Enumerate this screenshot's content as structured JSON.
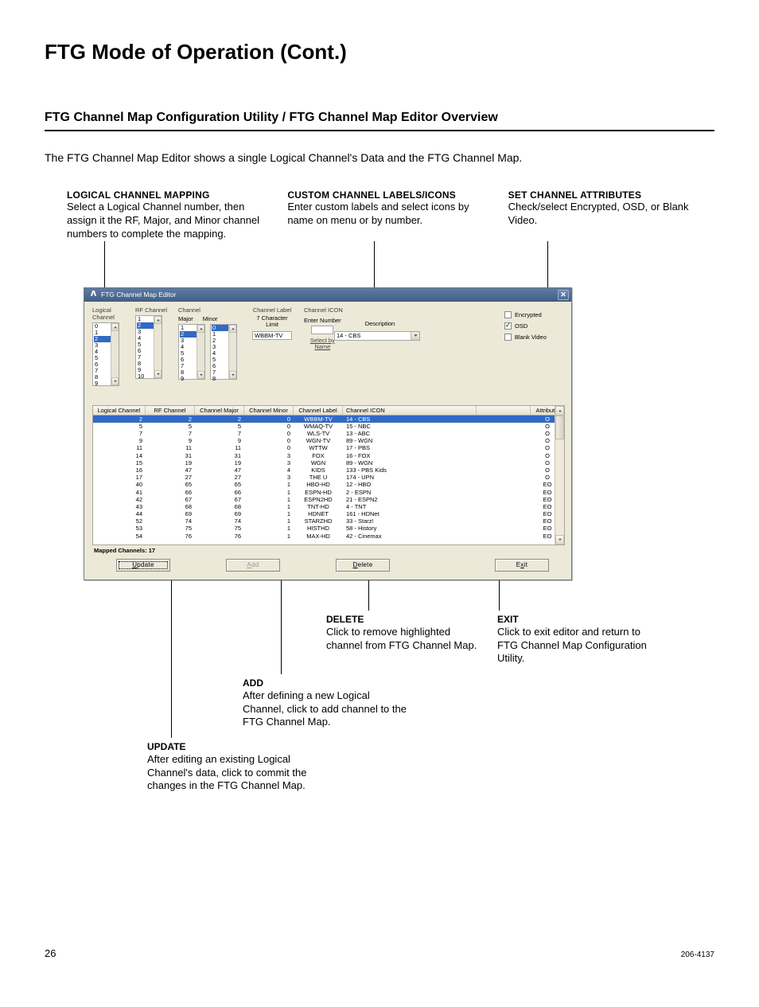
{
  "page": {
    "title": "FTG Mode of Operation (Cont.)",
    "subtitle": "FTG Channel Map Configuration Utility / FTG Channel Map Editor Overview",
    "intro": "The FTG Channel Map Editor shows a single Logical Channel's Data and the FTG Channel Map.",
    "number": "26",
    "docnum": "206-4137"
  },
  "callouts": {
    "top": [
      {
        "title": "LOGICAL CHANNEL MAPPING",
        "body": "Select a Logical Channel number, then assign it the RF, Major, and Minor channel numbers to complete the mapping."
      },
      {
        "title": "CUSTOM CHANNEL LABELS/ICONS",
        "body": "Enter custom labels and select icons by name on menu or by number."
      },
      {
        "title": "SET CHANNEL ATTRIBUTES",
        "body": "Check/select Encrypted, OSD, or Blank Video."
      }
    ],
    "bottom": {
      "delete": {
        "title": "DELETE",
        "body": "Click to remove highlighted channel from FTG Channel Map."
      },
      "exit": {
        "title": "EXIT",
        "body": "Click to exit editor and return to FTG Channel Map Configuration Utility."
      },
      "add": {
        "title": "ADD",
        "body": "After defining a new Logical Channel, click to add channel to the FTG Channel Map."
      },
      "update": {
        "title": "UPDATE",
        "body": "After editing an existing Logical Channel's data, click to commit the changes in the FTG Channel Map."
      }
    }
  },
  "dialog": {
    "title": "FTG Channel Map Editor",
    "labels": {
      "logical_channel": "Logical Channel",
      "rf_channel": "RF Channel",
      "channel": "Channel",
      "major": "Major",
      "minor": "Minor",
      "channel_label": "Channel Label",
      "seven_char_limit_a": "7 Character",
      "seven_char_limit_b": "Limit",
      "channel_icon": "Channel ICON",
      "enter_number": "Enter Number",
      "description": "Description",
      "select_by_name": "Select by\nName",
      "encrypted": "Encrypted",
      "osd": "OSD",
      "blank_video": "Blank Video",
      "mapped_channels": "Mapped Channels:  17"
    },
    "logical_items": [
      "0",
      "1",
      "2",
      "3",
      "4",
      "5",
      "6",
      "7",
      "8",
      "9"
    ],
    "logical_sel": 2,
    "rf_items": [
      "1",
      "2",
      "3",
      "4",
      "5",
      "6",
      "7",
      "8",
      "9",
      "10"
    ],
    "rf_sel": 1,
    "major_items": [
      "1",
      "2",
      "3",
      "4",
      "5",
      "6",
      "7",
      "8",
      "9"
    ],
    "major_sel": 1,
    "minor_items": [
      "0",
      "1",
      "2",
      "3",
      "4",
      "5",
      "6",
      "7",
      "8"
    ],
    "minor_sel": 0,
    "label_value": "WBBM-TV",
    "icon_value": "14 - CBS",
    "attrs": {
      "encrypted": false,
      "osd": true,
      "blank_video": false
    },
    "grid": {
      "headers": [
        "Logical Channel",
        "RF Channel",
        "Channel Major",
        "Channel Minor",
        "Channel Label",
        "Channel ICON",
        "",
        "Attribute"
      ],
      "rows": [
        {
          "lc": "2",
          "rf": "2",
          "maj": "2",
          "min": "0",
          "lbl": "WBBM-TV",
          "icon": "14 - CBS",
          "attr": "O",
          "sel": true
        },
        {
          "lc": "5",
          "rf": "5",
          "maj": "5",
          "min": "0",
          "lbl": "WMAQ-TV",
          "icon": "15 - NBC",
          "attr": "O"
        },
        {
          "lc": "7",
          "rf": "7",
          "maj": "7",
          "min": "0",
          "lbl": "WLS-TV",
          "icon": "13 - ABC",
          "attr": "O"
        },
        {
          "lc": "9",
          "rf": "9",
          "maj": "9",
          "min": "0",
          "lbl": "WGN-TV",
          "icon": "89 - WGN",
          "attr": "O"
        },
        {
          "lc": "11",
          "rf": "11",
          "maj": "11",
          "min": "0",
          "lbl": "WTTW",
          "icon": "17 - PBS",
          "attr": "O"
        },
        {
          "lc": "14",
          "rf": "31",
          "maj": "31",
          "min": "3",
          "lbl": "FOX",
          "icon": "16 - FOX",
          "attr": "O"
        },
        {
          "lc": "15",
          "rf": "19",
          "maj": "19",
          "min": "3",
          "lbl": "WGN",
          "icon": "89 - WGN",
          "attr": "O"
        },
        {
          "lc": "16",
          "rf": "47",
          "maj": "47",
          "min": "4",
          "lbl": "KIDS",
          "icon": "133 - PBS Kids",
          "attr": "O"
        },
        {
          "lc": "17",
          "rf": "27",
          "maj": "27",
          "min": "3",
          "lbl": "THE U",
          "icon": "174 - UPN",
          "attr": "O"
        },
        {
          "lc": "40",
          "rf": "65",
          "maj": "65",
          "min": "1",
          "lbl": "HBO-HD",
          "icon": "12 - HBO",
          "attr": "EO"
        },
        {
          "lc": "41",
          "rf": "66",
          "maj": "66",
          "min": "1",
          "lbl": "ESPN-HD",
          "icon": "2 - ESPN",
          "attr": "EO"
        },
        {
          "lc": "42",
          "rf": "67",
          "maj": "67",
          "min": "1",
          "lbl": "ESPN2HD",
          "icon": "21 - ESPN2",
          "attr": "EO"
        },
        {
          "lc": "43",
          "rf": "68",
          "maj": "68",
          "min": "1",
          "lbl": "TNT-HD",
          "icon": "4 - TNT",
          "attr": "EO"
        },
        {
          "lc": "44",
          "rf": "69",
          "maj": "69",
          "min": "1",
          "lbl": "HDNET",
          "icon": "161 - HDNet",
          "attr": "EO"
        },
        {
          "lc": "52",
          "rf": "74",
          "maj": "74",
          "min": "1",
          "lbl": "STARZHD",
          "icon": "33 - Starz!",
          "attr": "EO"
        },
        {
          "lc": "53",
          "rf": "75",
          "maj": "75",
          "min": "1",
          "lbl": "HISTHD",
          "icon": "58 - History",
          "attr": "EO"
        },
        {
          "lc": "54",
          "rf": "76",
          "maj": "76",
          "min": "1",
          "lbl": "MAX-HD",
          "icon": "42 - Cinemax",
          "attr": "EO"
        }
      ]
    },
    "buttons": {
      "update": "Update",
      "add": "Add",
      "delete": "Delete",
      "exit": "Exit"
    }
  }
}
